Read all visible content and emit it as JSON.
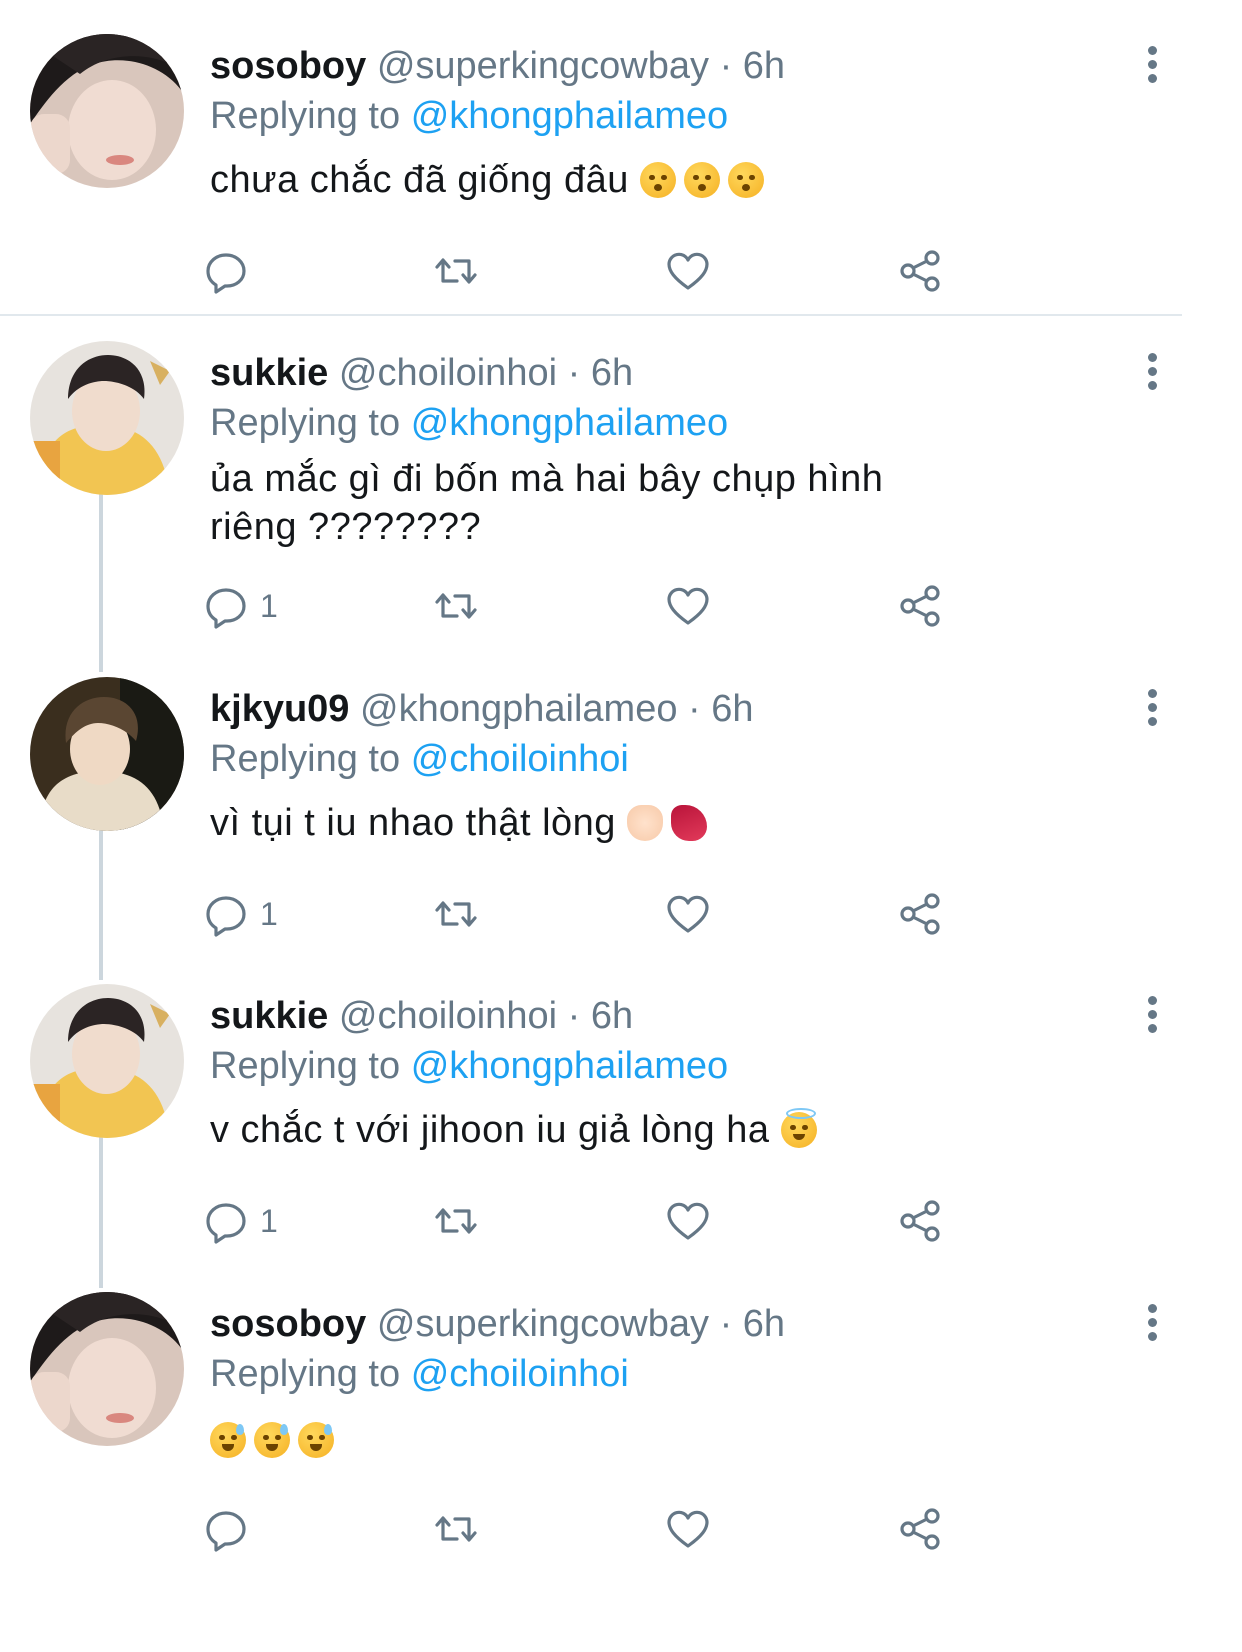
{
  "tweets": [
    {
      "name": "sosoboy",
      "handle": "@superkingcowbay",
      "dot": "·",
      "time": "6h",
      "replying_label": "Replying to",
      "replying_to": "@khongphailameo",
      "text": "chưa chắc đã giống đâu",
      "emojis": [
        "kissing-face-emoji",
        "kissing-face-emoji",
        "kissing-face-emoji"
      ],
      "reply_count": ""
    },
    {
      "name": "sukkie",
      "handle": "@choiloinhoi",
      "dot": "·",
      "time": "6h",
      "replying_label": "Replying to",
      "replying_to": "@khongphailameo",
      "text": "ủa mắc gì đi bốn mà hai bây chụp hình riêng ????????",
      "emojis": [],
      "reply_count": "1"
    },
    {
      "name": "kjkyu09",
      "handle": "@khongphailameo",
      "dot": "·",
      "time": "6h",
      "replying_label": "Replying to",
      "replying_to": "@choiloinhoi",
      "text": "vì tụi t iu nhao thật lòng",
      "emojis": [
        "heart-hands-emoji",
        "dancer-emoji"
      ],
      "reply_count": "1"
    },
    {
      "name": "sukkie",
      "handle": "@choiloinhoi",
      "dot": "·",
      "time": "6h",
      "replying_label": "Replying to",
      "replying_to": "@khongphailameo",
      "text": "v chắc t với jihoon iu giả lòng ha",
      "emojis": [
        "halo-smile-emoji"
      ],
      "reply_count": "1"
    },
    {
      "name": "sosoboy",
      "handle": "@superkingcowbay",
      "dot": "·",
      "time": "6h",
      "replying_label": "Replying to",
      "replying_to": "@choiloinhoi",
      "text": "",
      "emojis": [
        "sweat-smile-emoji",
        "sweat-smile-emoji",
        "sweat-smile-emoji"
      ],
      "reply_count": ""
    }
  ],
  "icons": {
    "reply": "reply-icon",
    "retweet": "retweet-icon",
    "like": "heart-icon",
    "share": "share-icon",
    "more": "more-vertical-icon"
  },
  "colors": {
    "link": "#1da1f2",
    "secondary": "#657786",
    "text": "#14171a",
    "divider": "#e1e8ed",
    "thread_line": "#ccd6dd"
  }
}
